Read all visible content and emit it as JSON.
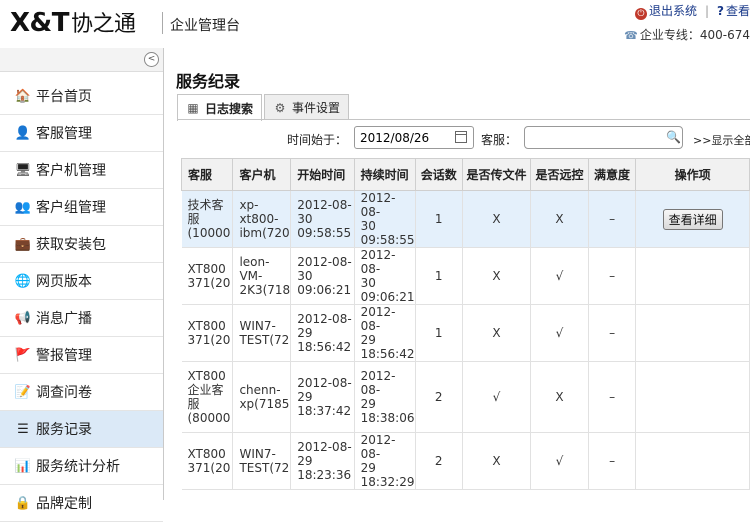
{
  "header": {
    "logo_main": "X&T",
    "logo_cn": "协之通",
    "subtitle": "企业管理台",
    "exit_label": "退出系统",
    "help_label": "查看",
    "hotline_label": "企业专线：400-674"
  },
  "sidebar": {
    "collapse_glyph": "<",
    "items": [
      {
        "label": "平台首页",
        "icon": "🏠"
      },
      {
        "label": "客服管理",
        "icon": "👤"
      },
      {
        "label": "客户机管理",
        "icon": "🖥"
      },
      {
        "label": "客户组管理",
        "icon": "👥"
      },
      {
        "label": "获取安装包",
        "icon": "💼"
      },
      {
        "label": "网页版本",
        "icon": "🌐"
      },
      {
        "label": "消息广播",
        "icon": "📢"
      },
      {
        "label": "警报管理",
        "icon": "🚩"
      },
      {
        "label": "调查问卷",
        "icon": "📝"
      },
      {
        "label": "服务记录",
        "icon": "☰"
      },
      {
        "label": "服务统计分析",
        "icon": "📊"
      },
      {
        "label": "品牌定制",
        "icon": "🔒"
      }
    ]
  },
  "main": {
    "title": "服务纪录",
    "tabs": [
      {
        "label": "日志搜索"
      },
      {
        "label": "事件设置"
      }
    ],
    "filter": {
      "start_time_label": "时间始于：",
      "start_time_value": "2012/08/26",
      "agent_label": "客服：",
      "agent_value": "",
      "show_all_label": ">>显示全部"
    },
    "table": {
      "columns": [
        "客服",
        "客户机",
        "开始时间",
        "持续时间",
        "会话数",
        "是否传文件",
        "是否远控",
        "满意度",
        "操作项"
      ],
      "detail_button": "查看详细",
      "rows": [
        {
          "agent": "技术客\n服\n(10000",
          "client": "xp-\nxt800-\nibm(720",
          "start": "2012-08-\n30\n09:58:55",
          "duration": "2012-08-\n30\n09:58:55",
          "sessions": "1",
          "file": "X",
          "remote": "X",
          "satisfaction": "–"
        },
        {
          "agent": "XT800\n371(20",
          "client": "leon-\nVM-\n2K3(718",
          "start": "2012-08-\n30\n09:06:21",
          "duration": "2012-08-\n30\n09:06:21",
          "sessions": "1",
          "file": "X",
          "remote": "√",
          "satisfaction": "–"
        },
        {
          "agent": "XT800\n371(20",
          "client": "WIN7-\nTEST(72",
          "start": "2012-08-\n29\n18:56:42",
          "duration": "2012-08-\n29\n18:56:42",
          "sessions": "1",
          "file": "X",
          "remote": "√",
          "satisfaction": "–"
        },
        {
          "agent": "XT800\n企业客\n服\n(80000",
          "client": "chenn-\nxp(7185",
          "start": "2012-08-\n29\n18:37:42",
          "duration": "2012-08-\n29\n18:38:06",
          "sessions": "2",
          "file": "√",
          "remote": "X",
          "satisfaction": "–"
        },
        {
          "agent": "XT800\n371(20",
          "client": "WIN7-\nTEST(72",
          "start": "2012-08-\n29\n18:23:36",
          "duration": "2012-08-\n29\n18:32:29",
          "sessions": "2",
          "file": "X",
          "remote": "√",
          "satisfaction": "–"
        }
      ]
    }
  }
}
